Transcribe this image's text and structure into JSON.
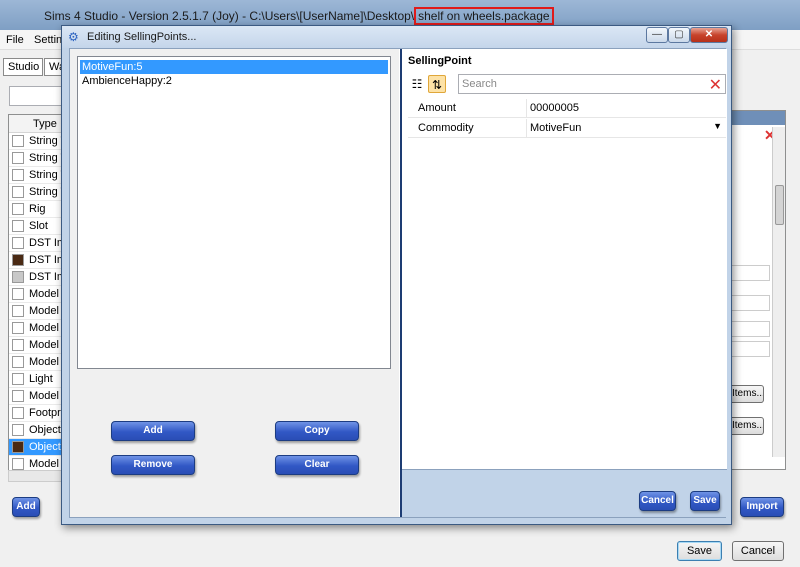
{
  "main_window": {
    "title_prefix": "Sims 4 Studio - Version 2.5.1.7  (Joy)   - C:\\Users\\[UserName]\\Desktop\\",
    "title_file": "shelf on wheels.package",
    "menu": [
      "File",
      "Settin"
    ],
    "tabs": [
      "Studio",
      "Wa"
    ],
    "column_header": "Type",
    "rows": [
      {
        "label": "String T",
        "thumb": "white"
      },
      {
        "label": "String T",
        "thumb": "white"
      },
      {
        "label": "String T",
        "thumb": "white"
      },
      {
        "label": "String T",
        "thumb": "white"
      },
      {
        "label": "Rig",
        "thumb": "white"
      },
      {
        "label": "Slot",
        "thumb": "white"
      },
      {
        "label": "DST Ima",
        "thumb": "white"
      },
      {
        "label": "DST Ima",
        "thumb": "dark"
      },
      {
        "label": "DST Ima",
        "thumb": "grey"
      },
      {
        "label": "Model L",
        "thumb": "white"
      },
      {
        "label": "Model L",
        "thumb": "white"
      },
      {
        "label": "Model L",
        "thumb": "white"
      },
      {
        "label": "Model L",
        "thumb": "white"
      },
      {
        "label": "Model L",
        "thumb": "white"
      },
      {
        "label": "Light",
        "thumb": "white"
      },
      {
        "label": "Model",
        "thumb": "white"
      },
      {
        "label": "Footpri",
        "thumb": "white"
      },
      {
        "label": "Object",
        "thumb": "white"
      },
      {
        "label": "Object C",
        "thumb": "dark",
        "selected": true
      },
      {
        "label": "Model T",
        "thumb": "white"
      }
    ],
    "items_button_label": "Items...",
    "add_label": "Add",
    "import_label": "Import",
    "save_label": "Save",
    "cancel_label": "Cancel"
  },
  "dialog": {
    "title": "Editing SellingPoints...",
    "list_items": [
      {
        "label": "MotiveFun:5",
        "selected": true
      },
      {
        "label": "AmbienceHappy:2",
        "selected": false
      }
    ],
    "buttons": {
      "add": "Add",
      "copy": "Copy",
      "remove": "Remove",
      "clear": "Clear",
      "cancel": "Cancel",
      "save": "Save"
    },
    "property_grid": {
      "header": "SellingPoint",
      "search_placeholder": "Search",
      "rows": [
        {
          "name": "Amount",
          "value": "00000005"
        },
        {
          "name": "Commodity",
          "value": "MotiveFun",
          "dropdown": true
        }
      ]
    },
    "caption": {
      "minimize": "—",
      "maximize": "▢",
      "close": "✕"
    }
  },
  "icons": {
    "dialog_icon": "selling-points-icon",
    "categorized": "categorized-icon",
    "sort_az": "sort-alphabetical-icon",
    "clear_search": "clear-search-icon"
  }
}
